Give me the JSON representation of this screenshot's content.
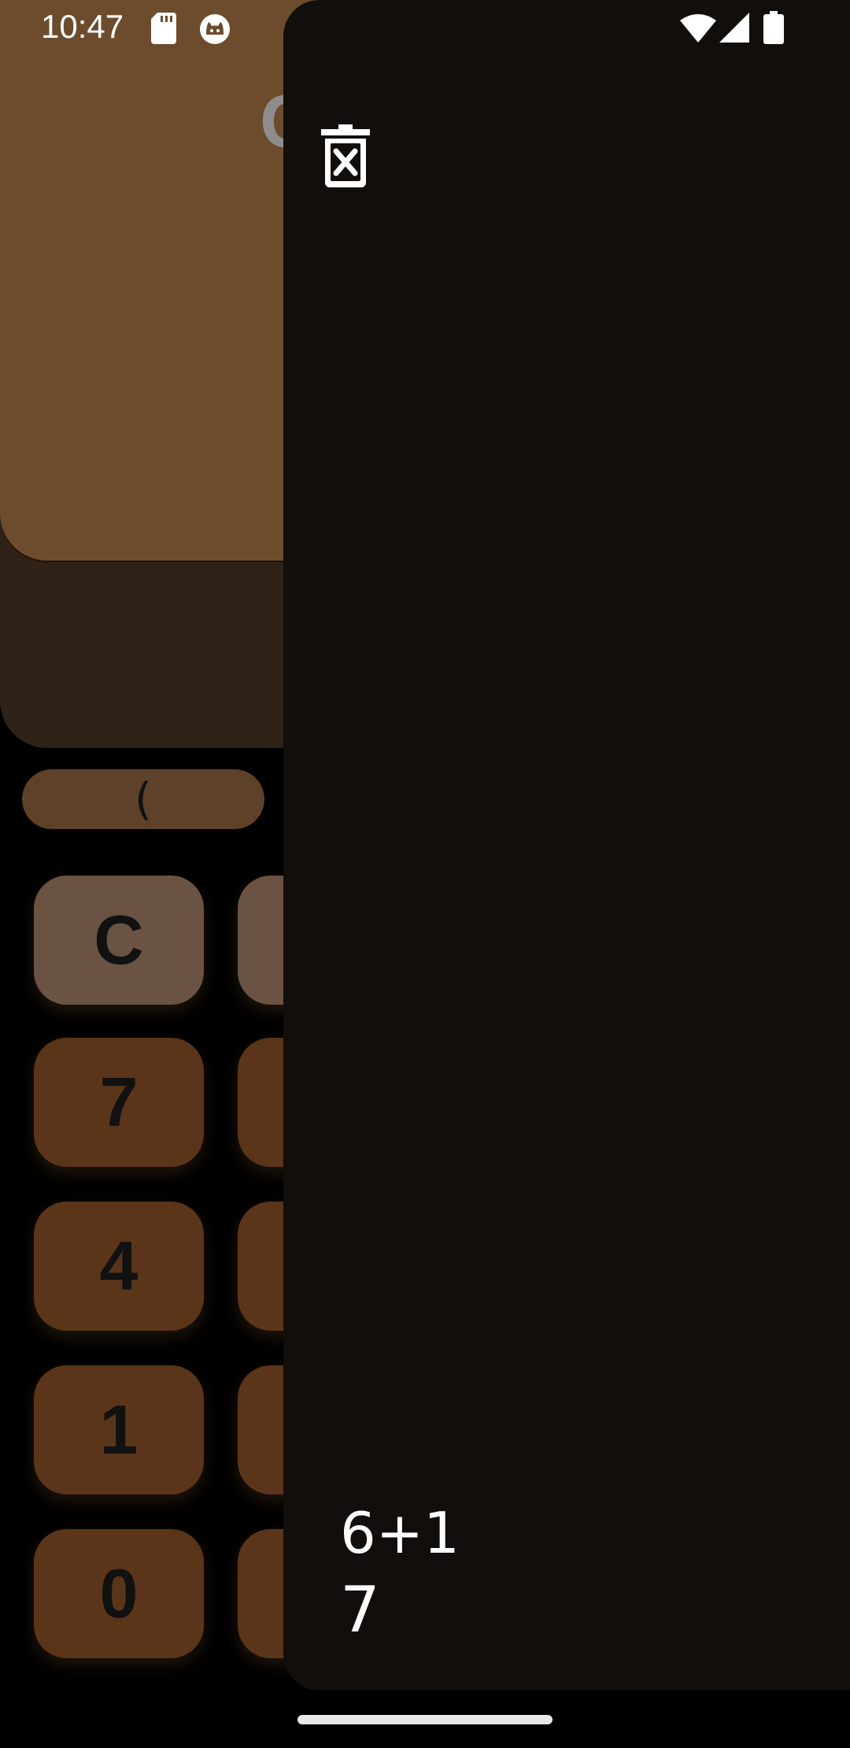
{
  "status_bar": {
    "time": "10:47",
    "left_icons": [
      "sd-card-icon",
      "cat-notification-icon"
    ],
    "right_icons": [
      "wifi-icon",
      "cell-signal-icon",
      "battery-icon"
    ]
  },
  "calculator": {
    "display_partial_text": "C",
    "function_row": {
      "open_paren": "("
    },
    "keys": {
      "clear": "C",
      "seven": "7",
      "four": "4",
      "one": "1",
      "zero": "0",
      "second_col_partial": "+"
    }
  },
  "history_drawer": {
    "clear_history_icon": "trash-x-icon",
    "entries": [
      {
        "expression": "6+1",
        "result": "7"
      }
    ]
  },
  "colors": {
    "display_top": "#6c4c2d",
    "display_bottom": "#2f2216",
    "number_key": "#5a3519",
    "clear_key": "#6a5343",
    "drawer_bg": "#110e0b"
  }
}
